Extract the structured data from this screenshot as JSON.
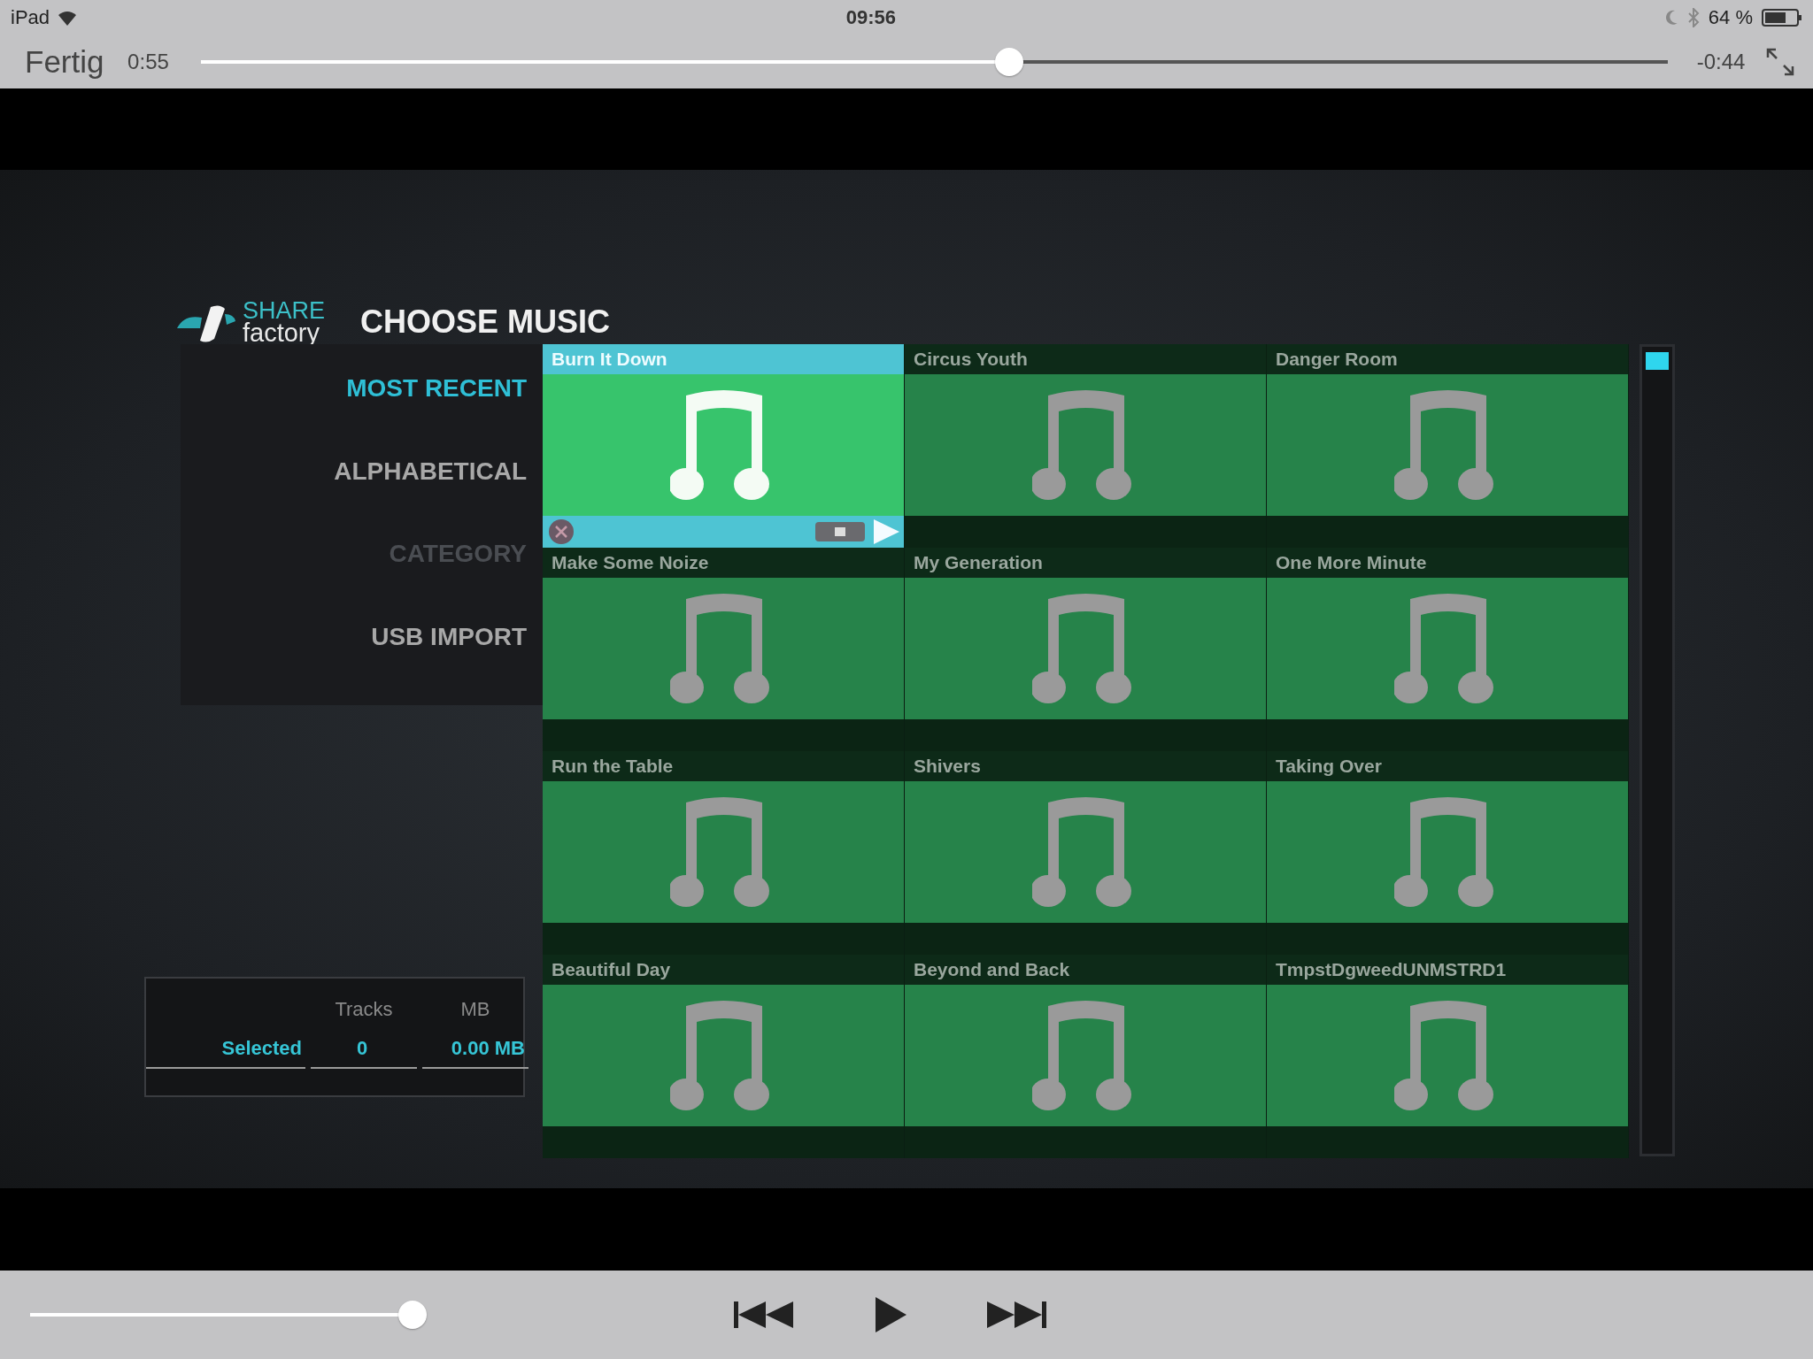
{
  "status_bar": {
    "device": "iPad",
    "time": "09:56",
    "battery": "64 %"
  },
  "player": {
    "done": "Fertig",
    "elapsed": "0:55",
    "remaining": "-0:44",
    "level": 0.551
  },
  "video": {
    "logo": {
      "top": "SHARE",
      "bottom": "factory"
    },
    "title": "CHOOSE MUSIC",
    "menu": [
      {
        "label": "MOST RECENT",
        "selected": true,
        "disabled": false
      },
      {
        "label": "ALPHABETICAL",
        "selected": false,
        "disabled": false
      },
      {
        "label": "CATEGORY",
        "selected": false,
        "disabled": true
      },
      {
        "label": "USB IMPORT",
        "selected": false,
        "disabled": false
      }
    ],
    "tracks": [
      {
        "title": "Burn It Down",
        "selected": true
      },
      {
        "title": "Circus Youth",
        "selected": false
      },
      {
        "title": "Danger Room",
        "selected": false
      },
      {
        "title": "Make Some Noize",
        "selected": false
      },
      {
        "title": "My Generation",
        "selected": false
      },
      {
        "title": "One More Minute",
        "selected": false
      },
      {
        "title": "Run the Table",
        "selected": false
      },
      {
        "title": "Shivers",
        "selected": false
      },
      {
        "title": "Taking Over",
        "selected": false
      },
      {
        "title": "Beautiful Day",
        "selected": false
      },
      {
        "title": "Beyond and Back",
        "selected": false
      },
      {
        "title": "TmpstDgweedUNMSTRD1",
        "selected": false
      }
    ],
    "summary": {
      "columns": [
        "Tracks",
        "MB"
      ],
      "row_label": "Selected",
      "values": [
        "0",
        "0.00 MB"
      ]
    }
  },
  "volume": {
    "level": 0.97
  }
}
